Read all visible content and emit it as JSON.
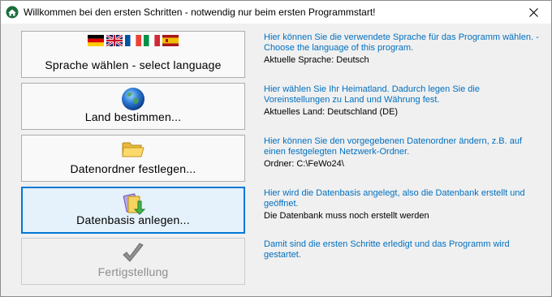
{
  "window": {
    "title": "Willkommen bei den ersten Schritten - notwendig nur beim ersten Programmstart!"
  },
  "steps": [
    {
      "button_label": "Sprache wählen - select language",
      "icon": "flags-icon",
      "description": "Hier können Sie die verwendete Sprache für das Programm wählen. - Choose the language of this program.",
      "status": "Aktuelle Sprache: Deutsch"
    },
    {
      "button_label": "Land bestimmen...",
      "icon": "globe-icon",
      "description": "Hier wählen Sie Ihr Heimatland. Dadurch legen Sie die Voreinstellungen zu Land und Währung fest.",
      "status": "Aktuelles Land: Deutschland (DE)"
    },
    {
      "button_label": "Datenordner festlegen...",
      "icon": "folder-icon",
      "description": "Hier können Sie den vorgegebenen Datenordner ändern, z.B. auf einen festgelegten Netzwerk-Ordner.",
      "status": "Ordner: C:\\FeWo24\\"
    },
    {
      "button_label": "Datenbasis anlegen...",
      "icon": "database-create-icon",
      "description": "Hier wird die Datenbasis angelegt, also die Datenbank erstellt und geöffnet.",
      "status": "Die Datenbank muss noch erstellt werden"
    },
    {
      "button_label": "Fertigstellung",
      "icon": "checkmark-icon",
      "description": "Damit sind die ersten Schritte erledigt und das Programm wird gestartet.",
      "status": ""
    }
  ],
  "colors": {
    "description_text": "#0070c0",
    "focus_border": "#0078d7",
    "focus_fill": "#e5f1fb",
    "disabled_text": "#8d8d8d"
  }
}
